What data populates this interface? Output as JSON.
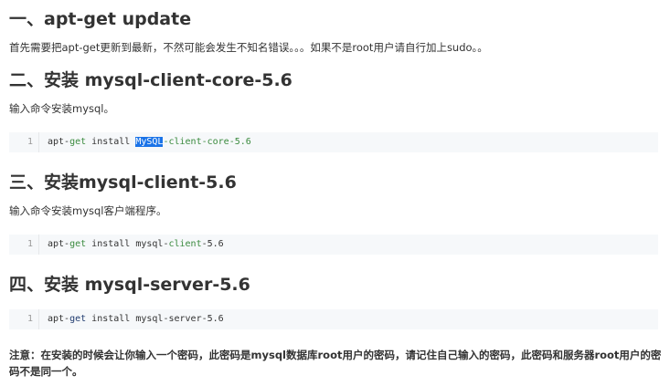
{
  "sections": [
    {
      "heading": "一、apt-get update",
      "paragraph": "首先需要把apt-get更新到最新，不然可能会发生不知名错误。。。如果不是root用户请自行加上sudo。。"
    },
    {
      "heading": "二、安装 mysql-client-core-5.6",
      "paragraph": "输入命令安装mysql。",
      "code": {
        "line_number": "1",
        "tokens": [
          {
            "text": "apt-",
            "style": "plain"
          },
          {
            "text": "get",
            "style": "green"
          },
          {
            "text": " install ",
            "style": "plain"
          },
          {
            "text": "MySQL",
            "style": "highlight"
          },
          {
            "text": "-client-core-5.6",
            "style": "green"
          }
        ]
      }
    },
    {
      "heading": "三、安装mysql-client-5.6",
      "paragraph": "输入命令安装mysql客户端程序。",
      "code": {
        "line_number": "1",
        "tokens": [
          {
            "text": "apt-",
            "style": "plain"
          },
          {
            "text": "get",
            "style": "green"
          },
          {
            "text": " install mysql-",
            "style": "plain"
          },
          {
            "text": "client",
            "style": "green"
          },
          {
            "text": "-5.6",
            "style": "plain"
          }
        ]
      }
    },
    {
      "heading": "四、安装 mysql-server-5.6",
      "code": {
        "line_number": "1",
        "tokens": [
          {
            "text": "apt-",
            "style": "plain"
          },
          {
            "text": "get",
            "style": "navy"
          },
          {
            "text": " install mysql-server-5.6",
            "style": "plain"
          }
        ]
      }
    }
  ],
  "note": "注意：在安装的时候会让你输入一个密码，此密码是mysql数据库root用户的密码，请记住自己输入的密码，此密码和服务器root用户的密码不是同一个。"
}
